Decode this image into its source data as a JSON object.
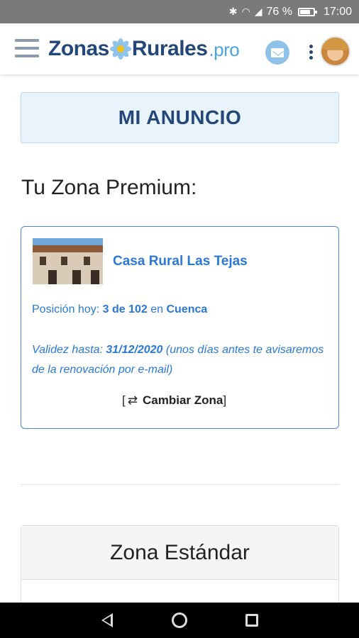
{
  "status_bar": {
    "battery_text": "76 %",
    "battery_level": 0.76,
    "time": "17:00",
    "icons": [
      "bluetooth-icon",
      "wifi-icon",
      "signal-icon",
      "battery-icon"
    ]
  },
  "header": {
    "logo_main": "Zonas",
    "logo_second": "Rurales",
    "logo_suffix": ".pro",
    "icons": [
      "menu-icon",
      "mail-icon",
      "more-vert-icon",
      "avatar"
    ]
  },
  "banner": {
    "title": "MI ANUNCIO"
  },
  "premium": {
    "heading": "Tu Zona Premium:",
    "card": {
      "listing_name": "Casa Rural Las Tejas",
      "position_label": "Posición hoy:",
      "position_value": "3 de 102",
      "position_connector": "en",
      "position_zone": "Cuenca",
      "validity_label": "Validez hasta:",
      "validity_date": "31/12/2020",
      "validity_note": "(unos días antes te avisaremos de la renovación por e-mail)",
      "change_zone_open": "[",
      "change_zone_label": "Cambiar Zona",
      "change_zone_close": "]"
    }
  },
  "standard": {
    "heading": "Zona Estándar"
  },
  "colors": {
    "brand_dark": "#24477a",
    "brand_light": "#4aa3df",
    "link_blue": "#2a78d6",
    "banner_bg": "#e8f3fc"
  },
  "nav_bar": {
    "icons": [
      "back-icon",
      "home-icon",
      "recents-icon"
    ]
  }
}
